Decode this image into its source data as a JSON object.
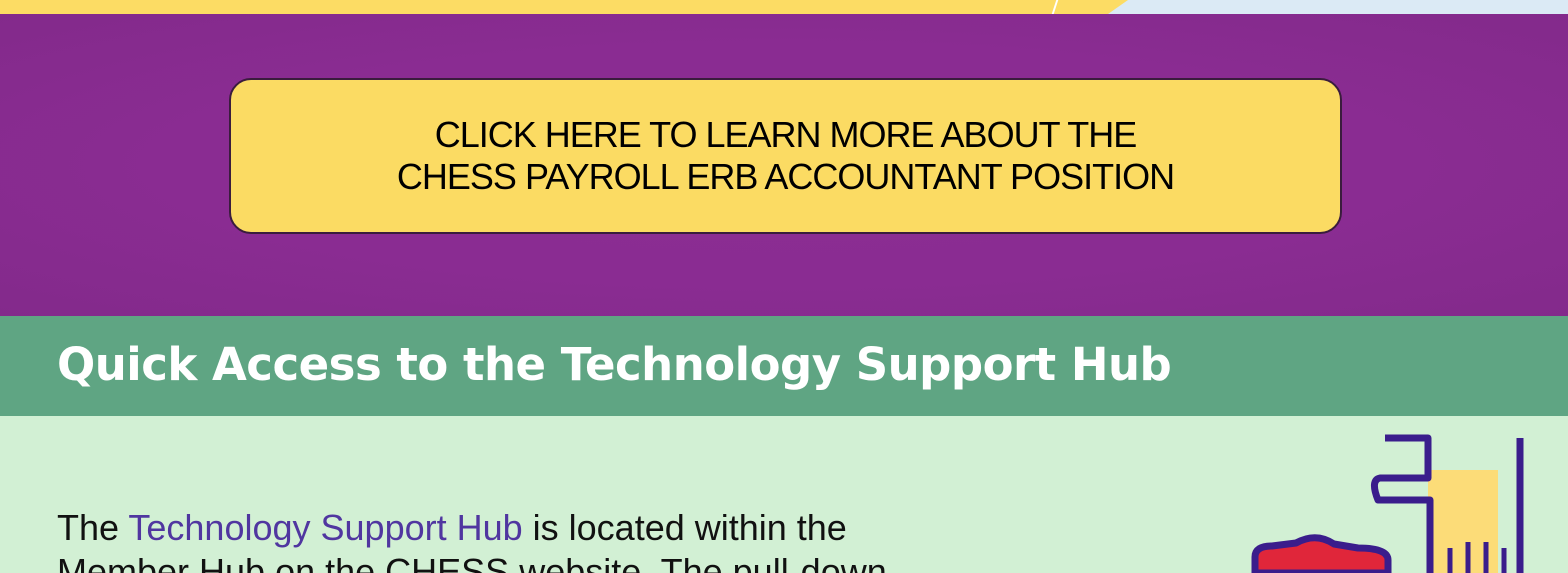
{
  "cta": {
    "line1": "CLICK HERE TO LEARN MORE ABOUT THE",
    "line2": "CHESS PAYROLL ERB ACCOUNTANT POSITION"
  },
  "section": {
    "title": "Quick Access to the Technology Support Hub"
  },
  "body": {
    "prefix": "The ",
    "link": "Technology Support Hub",
    "suffix": " is located within the",
    "line2": "Member Hub on the CHESS website. The pull-down"
  },
  "colors": {
    "purple": "#8a2c92",
    "yellow": "#fbdb63",
    "green_header": "#5fa583",
    "light_green": "#d2f0d4",
    "link": "#5036a0",
    "icon_stroke": "#3a1d8c",
    "icon_red": "#e0263a"
  },
  "icons": [
    "hand-with-shield-icon"
  ]
}
